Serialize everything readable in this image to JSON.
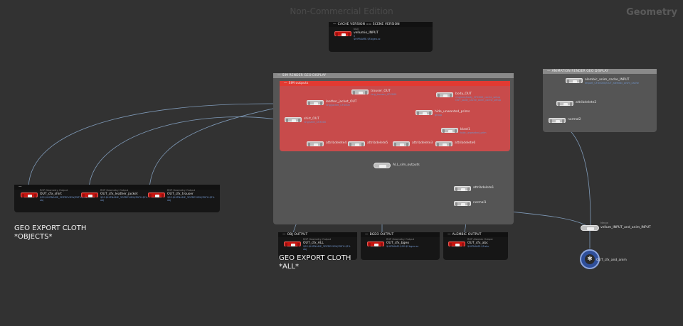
{
  "watermark": "Non-Commercial Edition",
  "context_title": "Geometry",
  "colors": {
    "background": "#323232",
    "red_node": "#c8140f",
    "network_box_red": "#c84b4b",
    "network_box_grey": "#555555",
    "wire": "#7f9ab8",
    "lop_node": "#2f4f9a"
  },
  "notes": {
    "export_objects": [
      "GEO EXPORT CLOTH",
      "*OBJECTS*"
    ],
    "export_all": [
      "GEO EXPORT CLOTH",
      "*ALL*"
    ]
  },
  "boxes": {
    "cache_version": {
      "title": "CACHE VERSION == SCENE VERSION"
    },
    "sim_render": {
      "title": "SIM RENDER GEO DISPLAY"
    },
    "sim_outputs": {
      "title": "SIM outputs"
    },
    "anim_render": {
      "title": "ANIMATION RENDER GEO DISPLAY"
    },
    "obj_out_left": {
      "title": ""
    },
    "obj_output": {
      "title": "OBJ OUTPUT"
    },
    "bgeo_output": {
      "title": "BGEO OUTPUT"
    },
    "alembic_output": {
      "title": "ALEMBIC OUTPUT"
    }
  },
  "nodes": {
    "vellumio": {
      "type": "Null",
      "name": "vellumio_INPUT",
      "parm": [
        "0",
        "$HIPNAME.$F.bgeo.sc"
      ]
    },
    "trouser_out": {
      "name": "trouser_OUT",
      "parm": [
        "",
        "ring_trouser_CFX000"
      ]
    },
    "body_out": {
      "name": "body_OUT",
      "parm": [
        "",
        "ring/sim/body_CFX000_cache_setup",
        "OUT_body_cache_anim_cache_setup"
      ]
    },
    "jacket_out": {
      "name": "leather_jacket_OUT",
      "parm": [
        "",
        "ring/jacket_CFX000"
      ]
    },
    "shirt_out": {
      "name": "shirt_OUT",
      "parm": [
        "",
        "ring/shirt_CFX000"
      ]
    },
    "hide_prims": {
      "name": "hide_unwanted_prims",
      "parm": [
        "",
        "group"
      ]
    },
    "blast1": {
      "name": "blast1",
      "parm": [
        "",
        "hide_unwanted_prim"
      ]
    },
    "attr4": {
      "name": "attribdelete4"
    },
    "attr5": {
      "name": "attribdelete5"
    },
    "attr3": {
      "name": "attribdelete3"
    },
    "attr6": {
      "name": "attribdelete6"
    },
    "all_sim_outputs": {
      "name": "ALL_sim_outputs"
    },
    "attr1": {
      "name": "attribdelete1"
    },
    "normal1": {
      "name": "normal1"
    },
    "anim_cache": {
      "name": "alembic_anim_cache_INPUT",
      "parm": [
        "",
        "Import_CFX0000/OUT_alembic_anim_cache"
      ]
    },
    "attr2": {
      "name": "attribdelete2"
    },
    "normal2": {
      "name": "normal2"
    },
    "merge_vellum": {
      "type": "Merge",
      "name": "vellum_INPUT_and_anim_INPUT"
    },
    "lop_node": {
      "name": "OUT_cfx_and_anim"
    },
    "rop_shirt": {
      "type": "ROP Geometry Output",
      "name": "OUT_cfx_shirt",
      "parm": [
        "",
        "$SS.$HIPNAME_3DPREVIEW/PATH.$F4.",
        "obj"
      ]
    },
    "rop_jacket": {
      "type": "ROP Geometry Output",
      "name": "OUT_cfx_leather_jacket",
      "parm": [
        "",
        "$SS.$HIPNAME_3DPREVIEW/PATH.$F4.",
        "obj"
      ]
    },
    "rop_trouser": {
      "type": "ROP Geometry Output",
      "name": "OUT_cfx_trouser",
      "parm": [
        "",
        "$SS.$HIPNAME_3DPREVIEW/PATH.$F4.",
        "obj"
      ]
    },
    "rop_all": {
      "type": "ROP Geometry Output",
      "name": "OUT_cfx_ALL",
      "parm": [
        "",
        "$SS.$HIPNAME_3DPREVIEW/PATH.$F4.",
        "obj"
      ]
    },
    "rop_bgeo": {
      "type": "ROP Geometry Output",
      "name": "OUT_cfx_bgeo",
      "parm": [
        "",
        "$HIPNAME.$SS.$F.bgeo.sc"
      ]
    },
    "rop_abc": {
      "type": "ROP Alembic Output",
      "name": "OUT_cfx_abc",
      "parm": [
        "",
        "$HIPNAME.$F.abc"
      ]
    }
  }
}
